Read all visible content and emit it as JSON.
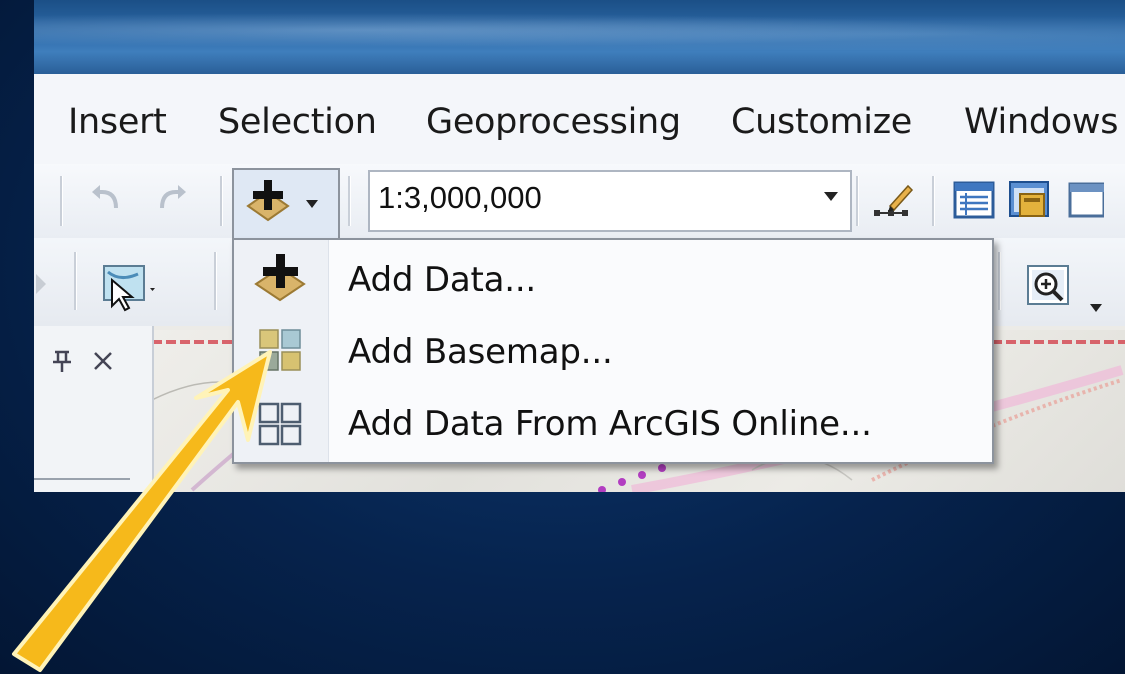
{
  "menu": {
    "items": [
      {
        "label": "Insert"
      },
      {
        "label": "Selection"
      },
      {
        "label": "Geoprocessing"
      },
      {
        "label": "Customize"
      },
      {
        "label": "Windows"
      }
    ]
  },
  "toolbar": {
    "scale_value": "1:3,000,000",
    "undo_icon": "undo-icon",
    "redo_icon": "redo-icon",
    "add_data_icon": "add-data-icon",
    "editor_icon": "editor-icon",
    "table_of_contents_icon": "table-icon",
    "catalog_icon": "catalog-icon",
    "select_features_icon": "select-features-icon",
    "zoom_icon": "zoom-in-icon"
  },
  "toc": {
    "pin_icon": "pin-icon",
    "close_icon": "close-icon"
  },
  "dropdown": {
    "items": [
      {
        "label": "Add Data...",
        "icon": "add-data-icon"
      },
      {
        "label": "Add Basemap...",
        "icon": "basemap-icon"
      },
      {
        "label": "Add Data From ArcGIS Online...",
        "icon": "arcgis-online-icon"
      }
    ]
  },
  "annotation": {
    "arrow_icon": "pointer-arrow-icon",
    "arrow_color": "#f6b91b"
  },
  "colors": {
    "background": "#06234d",
    "menu_bar": "#f4f6fa",
    "dropdown_border": "#8c939d"
  }
}
